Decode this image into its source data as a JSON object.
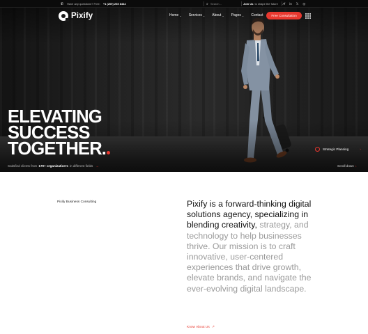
{
  "topbar": {
    "phone_label": "Have any questions? Free: ",
    "phone_number": "+1 (209) 265 8444",
    "search_placeholder": "Search...",
    "join_prefix": "Join Us",
    "join_suffix": "to shape the future",
    "socials": [
      "f",
      "in",
      "𝕏",
      "◎"
    ]
  },
  "brand": {
    "name": "Pixify"
  },
  "nav": {
    "items": [
      "Home",
      "Services",
      "About",
      "Pages",
      "Contact"
    ],
    "cta": "Free Consultation"
  },
  "hero": {
    "headline": [
      "ELEVATING",
      "SUCCESS",
      "TOGETHER."
    ],
    "clients_prefix": "Satisfied clients from",
    "clients_count": "170+ organization's",
    "clients_suffix": "in different fields",
    "strategic": "Strategic Planning",
    "scroll": "Scroll down"
  },
  "about": {
    "label": "Pixify Business Consulting",
    "text_dark": "Pixify is a forward-thinking digital solutions agency, specializing in blending creativity,",
    "text_muted": " strategy, and technology to help businesses thrive. Our mission is to craft innovative, user-centered experiences that drive growth, elevate brands, and navigate the ever-evolving digital landscape.",
    "link": "Know About Us"
  },
  "colors": {
    "accent": "#e8382f",
    "dark": "#0b0b0b",
    "muted_text": "#9a9a9a"
  }
}
